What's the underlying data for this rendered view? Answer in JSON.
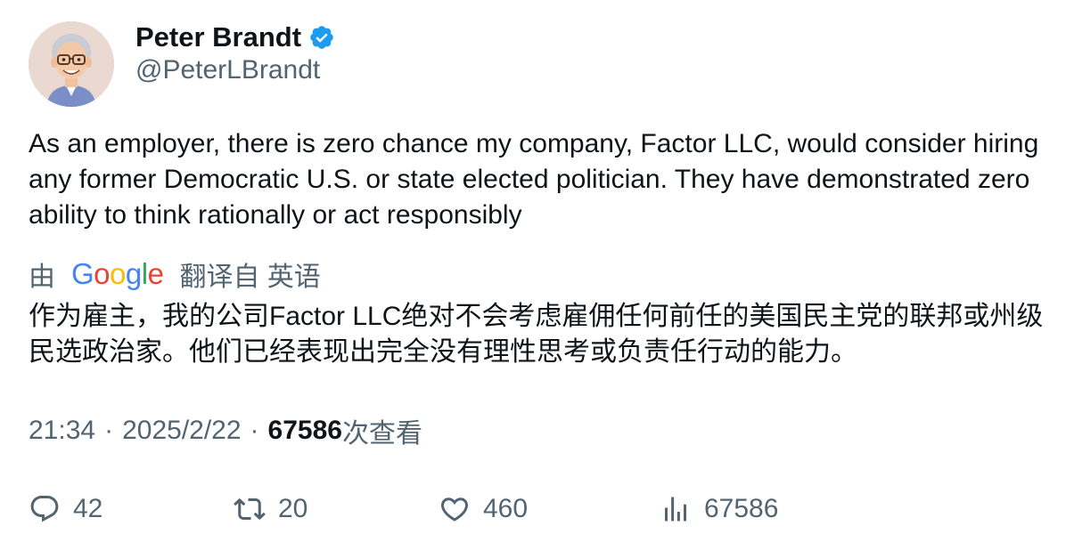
{
  "author": {
    "display_name": "Peter Brandt",
    "handle": "@PeterLBrandt",
    "verified": true,
    "verified_color": "#1d9bf0",
    "avatar_icon": "cartoon-avatar"
  },
  "tweet": {
    "text": "As an employer, there is zero chance my company, Factor LLC, would consider hiring any former Democratic U.S. or state elected politician. They have demonstrated zero ability to think rationally or act responsibly"
  },
  "translation": {
    "prefix": "由",
    "provider_letters": [
      "G",
      "o",
      "o",
      "g",
      "l",
      "e"
    ],
    "suffix": "翻译自 英语",
    "text": "作为雇主，我的公司Factor LLC绝对不会考虑雇佣任何前任的美国民主党的联邦或州级民选政治家。他们已经表现出完全没有理性思考或负责任行动的能力。"
  },
  "meta": {
    "time": "21:34",
    "separator": "·",
    "date": "2025/2/22",
    "views_count": "67586",
    "views_label": "次查看"
  },
  "actions": {
    "reply": {
      "icon": "reply-icon",
      "count": "42"
    },
    "retweet": {
      "icon": "retweet-icon",
      "count": "20"
    },
    "like": {
      "icon": "heart-icon",
      "count": "460"
    },
    "views": {
      "icon": "views-bar-chart-icon",
      "count": "67586"
    }
  },
  "colors": {
    "text_primary": "#0f1419",
    "text_secondary": "#536471",
    "google_blue": "#4285f4",
    "google_red": "#ea4335",
    "google_yellow": "#fbbc05",
    "google_green": "#34a853"
  }
}
